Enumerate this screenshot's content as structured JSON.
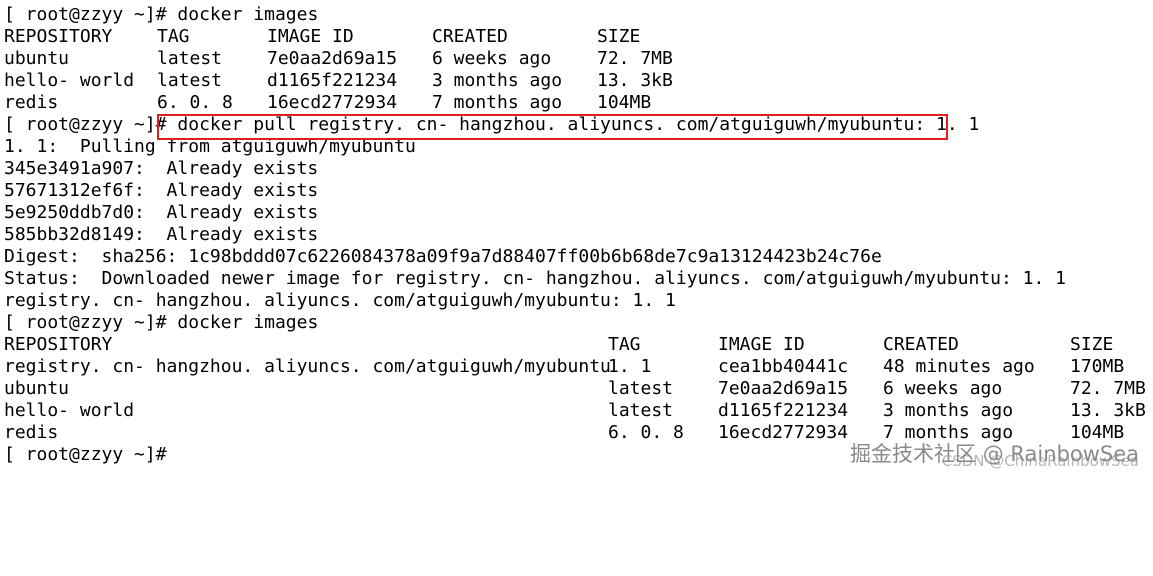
{
  "terminal": {
    "prompt": "[ root@zzyy ~]#",
    "cmd1": "docker images",
    "table1": {
      "headers": [
        "REPOSITORY",
        "TAG",
        "IMAGE ID",
        "CREATED",
        "SIZE"
      ],
      "rows": [
        [
          "ubuntu",
          "latest",
          "7e0aa2d69a15",
          "6 weeks ago",
          "72. 7MB"
        ],
        [
          "hello- world",
          "latest",
          "d1165f221234",
          "3 months ago",
          "13. 3kB"
        ],
        [
          "redis",
          "6. 0. 8",
          "16ecd2772934",
          "7 months ago",
          "104MB"
        ]
      ]
    },
    "cmd2": "docker pull registry. cn- hangzhou. aliyuncs. com/atguiguwh/myubuntu: 1. 1",
    "pull_output": [
      "1. 1:  Pulling from atguiguwh/myubuntu",
      "345e3491a907:  Already exists",
      "57671312ef6f:  Already exists",
      "5e9250ddb7d0:  Already exists",
      "585bb32d8149:  Already exists",
      "Digest:  sha256: 1c98bddd07c6226084378a09f9a7d88407ff00b6b68de7c9a13124423b24c76e",
      "Status:  Downloaded newer image for registry. cn- hangzhou. aliyuncs. com/atguiguwh/myubuntu: 1. 1",
      "registry. cn- hangzhou. aliyuncs. com/atguiguwh/myubuntu: 1. 1"
    ],
    "cmd3": "docker images",
    "table2": {
      "headers": [
        "REPOSITORY",
        "TAG",
        "IMAGE ID",
        "CREATED",
        "SIZE"
      ],
      "rows": [
        [
          "registry. cn- hangzhou. aliyuncs. com/atguiguwh/myubuntu",
          "1. 1",
          "cea1bb40441c",
          "48 minutes ago",
          "170MB"
        ],
        [
          "ubuntu",
          "latest",
          "7e0aa2d69a15",
          "6 weeks ago",
          "72. 7MB"
        ],
        [
          "hello- world",
          "latest",
          "d1165f221234",
          "3 months ago",
          "13. 3kB"
        ],
        [
          "redis",
          "6. 0. 8",
          "16ecd2772934",
          "7 months ago",
          "104MB"
        ]
      ]
    }
  },
  "watermark": {
    "line1": "掘金技术社区 @ RainbowSea",
    "line2": "CSDN @ChinaRainbowSea"
  },
  "colors": {
    "background": "#ffffff",
    "text": "#000000",
    "highlight": "#e02020"
  }
}
